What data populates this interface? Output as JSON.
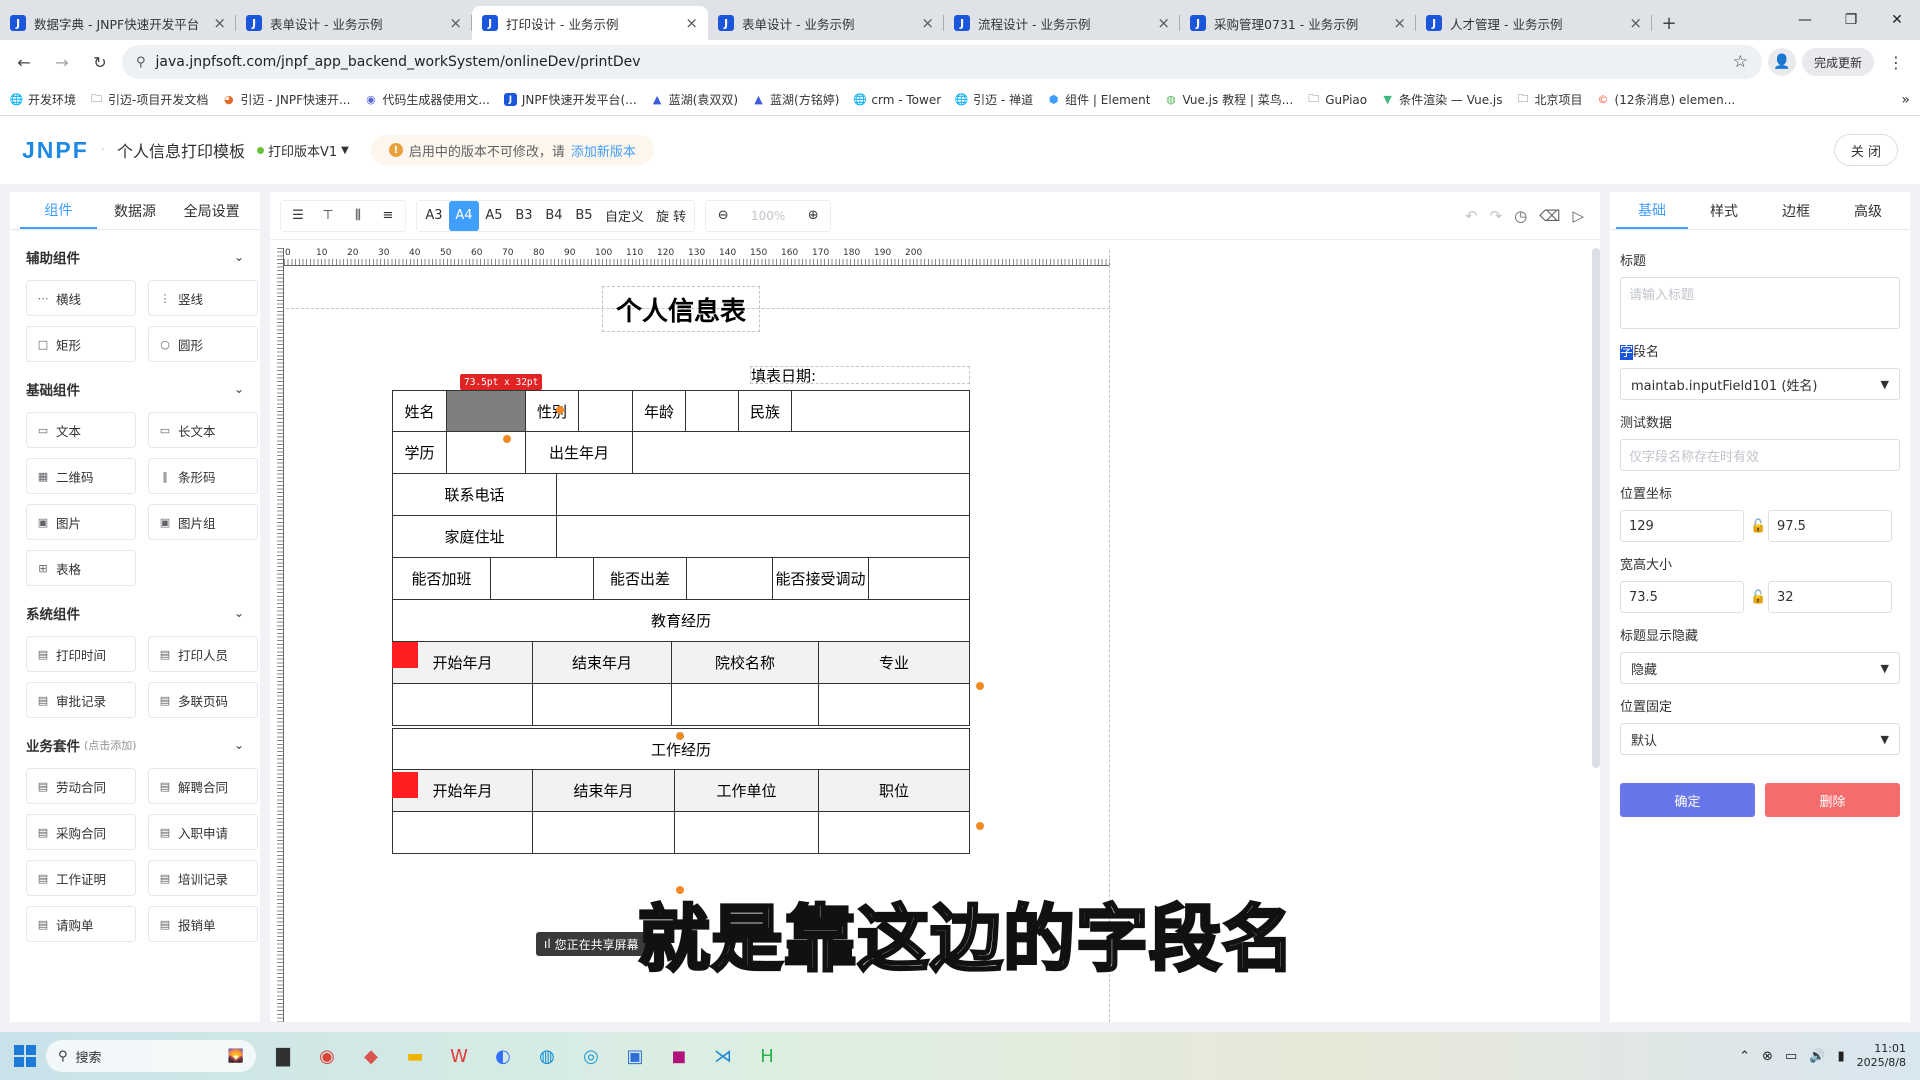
{
  "browser": {
    "tabs": [
      {
        "title": "数据字典 - JNPF快速开发平台"
      },
      {
        "title": "表单设计 - 业务示例"
      },
      {
        "title": "打印设计 - 业务示例"
      },
      {
        "title": "表单设计 - 业务示例"
      },
      {
        "title": "流程设计 - 业务示例"
      },
      {
        "title": "采购管理0731 - 业务示例"
      },
      {
        "title": "人才管理 - 业务示例"
      }
    ],
    "url": "java.jnpfsoft.com/jnpf_app_backend_workSystem/onlineDev/printDev",
    "update_label": "完成更新",
    "bookmarks": [
      "开发环境",
      "引迈-项目开发文档",
      "引迈 - JNPF快速开...",
      "代码生成器使用文...",
      "JNPF快速开发平台(...",
      "蓝湖(袁双双)",
      "蓝湖(方铭婷)",
      "crm - Tower",
      "引迈 - 禅道",
      "组件 | Element",
      "Vue.js 教程 | 菜鸟...",
      "GuPiao",
      "条件渲染 — Vue.js",
      "北京项目",
      "(12条消息) elemen..."
    ]
  },
  "header": {
    "logo": "JNPF",
    "title": "个人信息打印模板",
    "version": "打印版本V1",
    "notice_prefix": "启用中的版本不可修改，请",
    "notice_link": "添加新版本",
    "close_label": "关 闭"
  },
  "left": {
    "tabs": [
      "组件",
      "数据源",
      "全局设置"
    ],
    "sections": [
      {
        "title": "辅助组件",
        "items": [
          "横线",
          "竖线",
          "矩形",
          "圆形"
        ]
      },
      {
        "title": "基础组件",
        "items": [
          "文本",
          "长文本",
          "二维码",
          "条形码",
          "图片",
          "图片组",
          "表格"
        ]
      },
      {
        "title": "系统组件",
        "items": [
          "打印时间",
          "打印人员",
          "审批记录",
          "多联页码"
        ]
      },
      {
        "title": "业务套件",
        "hint": "(点击添加)",
        "items": [
          "劳动合同",
          "解聘合同",
          "采购合同",
          "入职申请",
          "工作证明",
          "培训记录",
          "请购单",
          "报销单"
        ]
      }
    ]
  },
  "toolbar": {
    "paper_sizes": [
      "A3",
      "A4",
      "A5",
      "B3",
      "B4",
      "B5"
    ],
    "selected_paper": "A4",
    "custom_label": "自定义",
    "rotate_label": "旋 转",
    "zoom": "100%"
  },
  "canvas": {
    "ruler_labels": [
      "0",
      "10",
      "20",
      "30",
      "40",
      "50",
      "60",
      "70",
      "80",
      "90",
      "100",
      "110",
      "120",
      "130",
      "140",
      "150",
      "160",
      "170",
      "180",
      "190",
      "200"
    ],
    "doc_title": "个人信息表",
    "fill_date": "填表日期:",
    "size_tag": "73.5pt x 32pt",
    "row1": [
      "姓名",
      "",
      "性别",
      "",
      "年龄",
      "",
      "民族",
      ""
    ],
    "row2": [
      "学历",
      "",
      "出生年月",
      ""
    ],
    "row3": [
      "联系电话",
      ""
    ],
    "row4": [
      "家庭住址",
      ""
    ],
    "row5": [
      "能否加班",
      "",
      "能否出差",
      "",
      "能否接受调动",
      ""
    ],
    "edu_title": "教育经历",
    "edu_headers": [
      "开始年月",
      "结束年月",
      "院校名称",
      "专业"
    ],
    "work_title": "工作经历",
    "work_headers": [
      "开始年月",
      "结束年月",
      "工作单位",
      "职位"
    ],
    "share_text": "您正在共享屏幕",
    "subtitle": "就是靠这边的字段名"
  },
  "right": {
    "tabs": [
      "基础",
      "样式",
      "边框",
      "高级"
    ],
    "title_label": "标题",
    "title_placeholder": "请输入标题",
    "field_label_hl": "字",
    "field_label_rest": "段名",
    "field_value": "maintab.inputField101 (姓名)",
    "test_label": "测试数据",
    "test_placeholder": "仅字段名称存在时有效",
    "pos_label": "位置坐标",
    "pos_x": "129",
    "pos_y": "97.5",
    "size_label": "宽高大小",
    "width": "73.5",
    "height": "32",
    "title_show_label": "标题显示隐藏",
    "title_show_value": "隐藏",
    "pos_fixed_label": "位置固定",
    "pos_fixed_value": "默认",
    "ok_label": "确定",
    "delete_label": "删除"
  },
  "taskbar": {
    "search": "搜索",
    "time": "11:01",
    "date": "2025/8/8"
  }
}
